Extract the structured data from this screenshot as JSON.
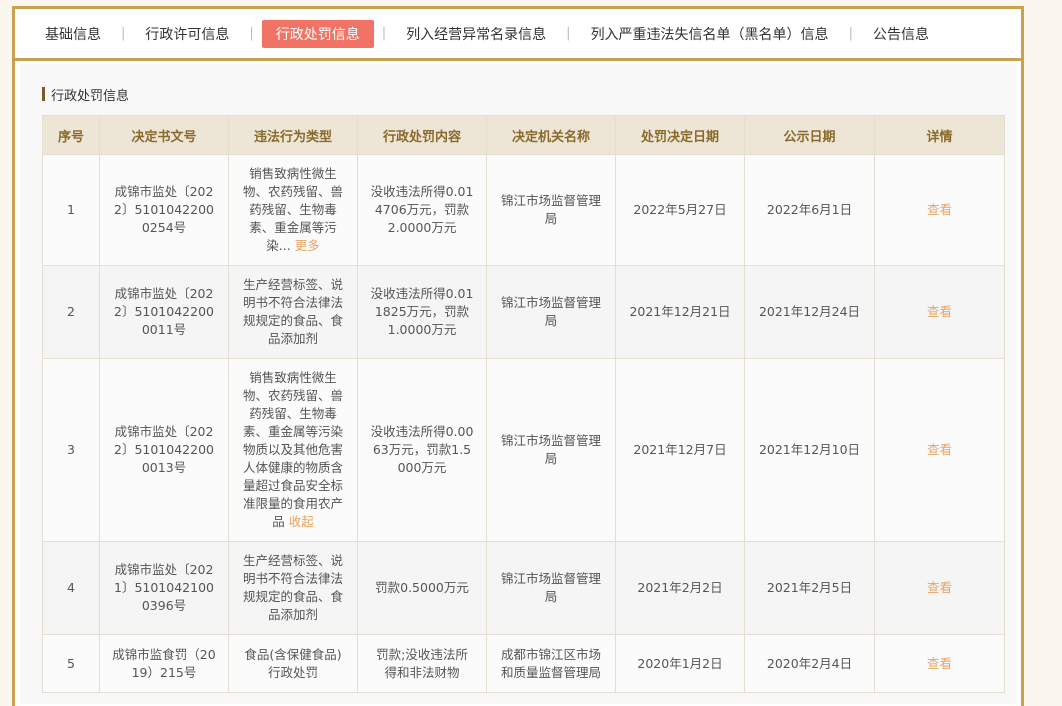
{
  "tabs": [
    {
      "label": "基础信息"
    },
    {
      "label": "行政许可信息"
    },
    {
      "label": "行政处罚信息"
    },
    {
      "label": "列入经营异常名录信息"
    },
    {
      "label": "列入严重违法失信名单（黑名单）信息"
    },
    {
      "label": "公告信息"
    }
  ],
  "section": {
    "title": "行政处罚信息"
  },
  "table": {
    "headers": [
      "序号",
      "决定书文号",
      "违法行为类型",
      "行政处罚内容",
      "决定机关名称",
      "处罚决定日期",
      "公示日期",
      "详情"
    ],
    "rows": [
      {
        "no": "1",
        "doc": "成锦市监处〔2022〕51010422000254号",
        "type": "销售致病性微生物、农药残留、兽药残留、生物毒素、重金属等污染...",
        "type_toggle": "更多",
        "content": "没收违法所得0.014706万元，罚款2.0000万元",
        "org": "锦江市场监督管理局",
        "decide": "2022年5月27日",
        "publish": "2022年6月1日",
        "detail": "查看"
      },
      {
        "no": "2",
        "doc": "成锦市监处〔2022〕51010422000011号",
        "type": "生产经营标签、说明书不符合法律法规规定的食品、食品添加剂",
        "type_toggle": "",
        "content": "没收违法所得0.011825万元，罚款1.0000万元",
        "org": "锦江市场监督管理局",
        "decide": "2021年12月21日",
        "publish": "2021年12月24日",
        "detail": "查看"
      },
      {
        "no": "3",
        "doc": "成锦市监处〔2022〕51010422000013号",
        "type": "销售致病性微生物、农药残留、兽药残留、生物毒素、重金属等污染物质以及其他危害人体健康的物质含量超过食品安全标准限量的食用农产品",
        "type_toggle": "收起",
        "content": "没收违法所得0.0063万元，罚款1.5000万元",
        "org": "锦江市场监督管理局",
        "decide": "2021年12月7日",
        "publish": "2021年12月10日",
        "detail": "查看"
      },
      {
        "no": "4",
        "doc": "成锦市监处〔2021〕51010421000396号",
        "type": "生产经营标签、说明书不符合法律法规规定的食品、食品添加剂",
        "type_toggle": "",
        "content": "罚款0.5000万元",
        "org": "锦江市场监督管理局",
        "decide": "2021年2月2日",
        "publish": "2021年2月5日",
        "detail": "查看"
      },
      {
        "no": "5",
        "doc": "成锦市监食罚（2019）215号",
        "type": "食品(含保健食品)行政处罚",
        "type_toggle": "",
        "content": "罚款;没收违法所得和非法财物",
        "org": "成都市锦江区市场和质量监督管理局",
        "decide": "2020年1月2日",
        "publish": "2020年2月4日",
        "detail": "查看"
      }
    ]
  }
}
